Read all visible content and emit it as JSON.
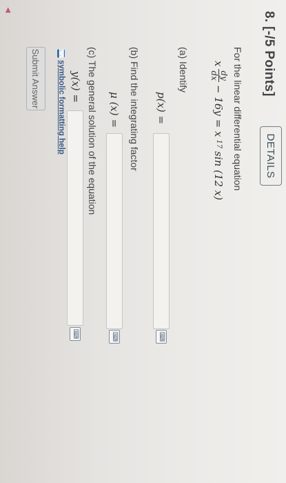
{
  "question": {
    "number_label": "8. [-/5 Points]",
    "details_label": "DETAILS"
  },
  "prompt": {
    "intro": "For the linear differential equation",
    "equation": {
      "coef": "x",
      "dy": "dy",
      "dx": "dx",
      "middle": "− 16y = x",
      "exponent": "17",
      "rhs": "sin (12 x)"
    }
  },
  "part_a": {
    "label": "(a) Identify",
    "input_label": "p(x) ="
  },
  "part_b": {
    "label": "(b) Find the integrating factor",
    "input_label": "μ (x) ="
  },
  "part_c": {
    "label": "(c) The general solution of the equation",
    "input_label": "y(x) ="
  },
  "help": {
    "icon": "keyboard-icon",
    "label": "symbolic formatting help"
  },
  "submit": {
    "label": "Submit Answer"
  },
  "colors": {
    "link": "#3b5b86",
    "details_border": "#6f7f86",
    "marker": "#b95a7f"
  }
}
